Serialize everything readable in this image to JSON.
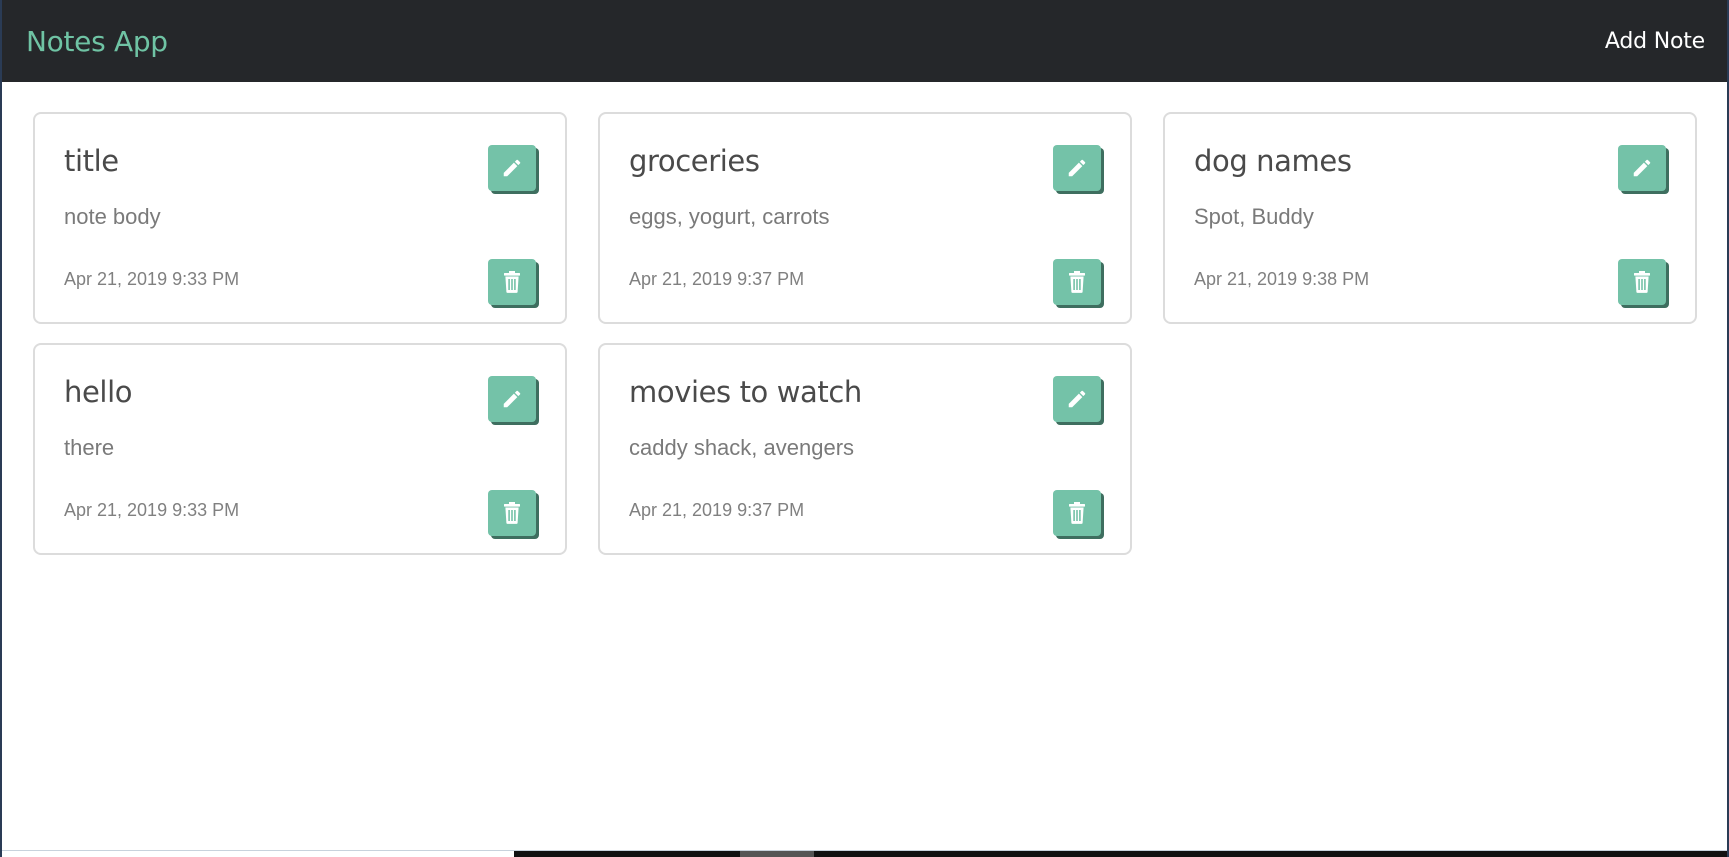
{
  "navbar": {
    "brand": "Notes App",
    "add_note_label": "Add Note"
  },
  "colors": {
    "navbar_bg": "#25272a",
    "brand": "#6fc3a4",
    "button_bg": "#74c2a8"
  },
  "icons": {
    "edit": "pencil-icon",
    "delete": "trash-icon"
  },
  "notes": [
    {
      "title": "title",
      "body": "note body",
      "date": "Apr 21, 2019 9:33 PM"
    },
    {
      "title": "groceries",
      "body": "eggs, yogurt, carrots",
      "date": "Apr 21, 2019 9:37 PM"
    },
    {
      "title": "dog names",
      "body": "Spot, Buddy",
      "date": "Apr 21, 2019 9:38 PM"
    },
    {
      "title": "hello",
      "body": "there",
      "date": "Apr 21, 2019 9:33 PM"
    },
    {
      "title": "movies to watch",
      "body": "caddy shack, avengers",
      "date": "Apr 21, 2019 9:37 PM"
    }
  ]
}
